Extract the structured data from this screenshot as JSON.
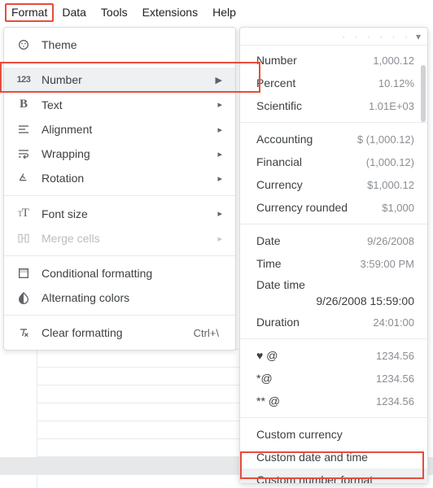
{
  "menubar": [
    "Format",
    "Data",
    "Tools",
    "Extensions",
    "Help"
  ],
  "menubar_selected_index": 0,
  "format_menu": {
    "theme": "Theme",
    "number": "Number",
    "text": "Text",
    "alignment": "Alignment",
    "wrapping": "Wrapping",
    "rotation": "Rotation",
    "font_size": "Font size",
    "merge_cells": "Merge cells",
    "conditional_formatting": "Conditional formatting",
    "alternating_colors": "Alternating colors",
    "clear_formatting": "Clear formatting",
    "clear_formatting_shortcut": "Ctrl+\\"
  },
  "number_submenu": {
    "items": [
      {
        "name": "Number",
        "example": "1,000.12"
      },
      {
        "name": "Percent",
        "example": "10.12%"
      },
      {
        "name": "Scientific",
        "example": "1.01E+03"
      }
    ],
    "finance": [
      {
        "name": "Accounting",
        "example": "$ (1,000.12)"
      },
      {
        "name": "Financial",
        "example": "(1,000.12)"
      },
      {
        "name": "Currency",
        "example": "$1,000.12"
      },
      {
        "name": "Currency rounded",
        "example": "$1,000"
      }
    ],
    "datetime": [
      {
        "name": "Date",
        "example": "9/26/2008"
      },
      {
        "name": "Time",
        "example": "3:59:00 PM"
      },
      {
        "name": "Date time",
        "example": "9/26/2008 15:59:00"
      },
      {
        "name": "Duration",
        "example": "24:01:00"
      }
    ],
    "tokens": [
      {
        "name": "♥ @",
        "example": "1234.56"
      },
      {
        "name": "*@",
        "example": "1234.56"
      },
      {
        "name": "** @",
        "example": "1234.56"
      }
    ],
    "custom": [
      "Custom currency",
      "Custom date and time",
      "Custom number format"
    ]
  }
}
